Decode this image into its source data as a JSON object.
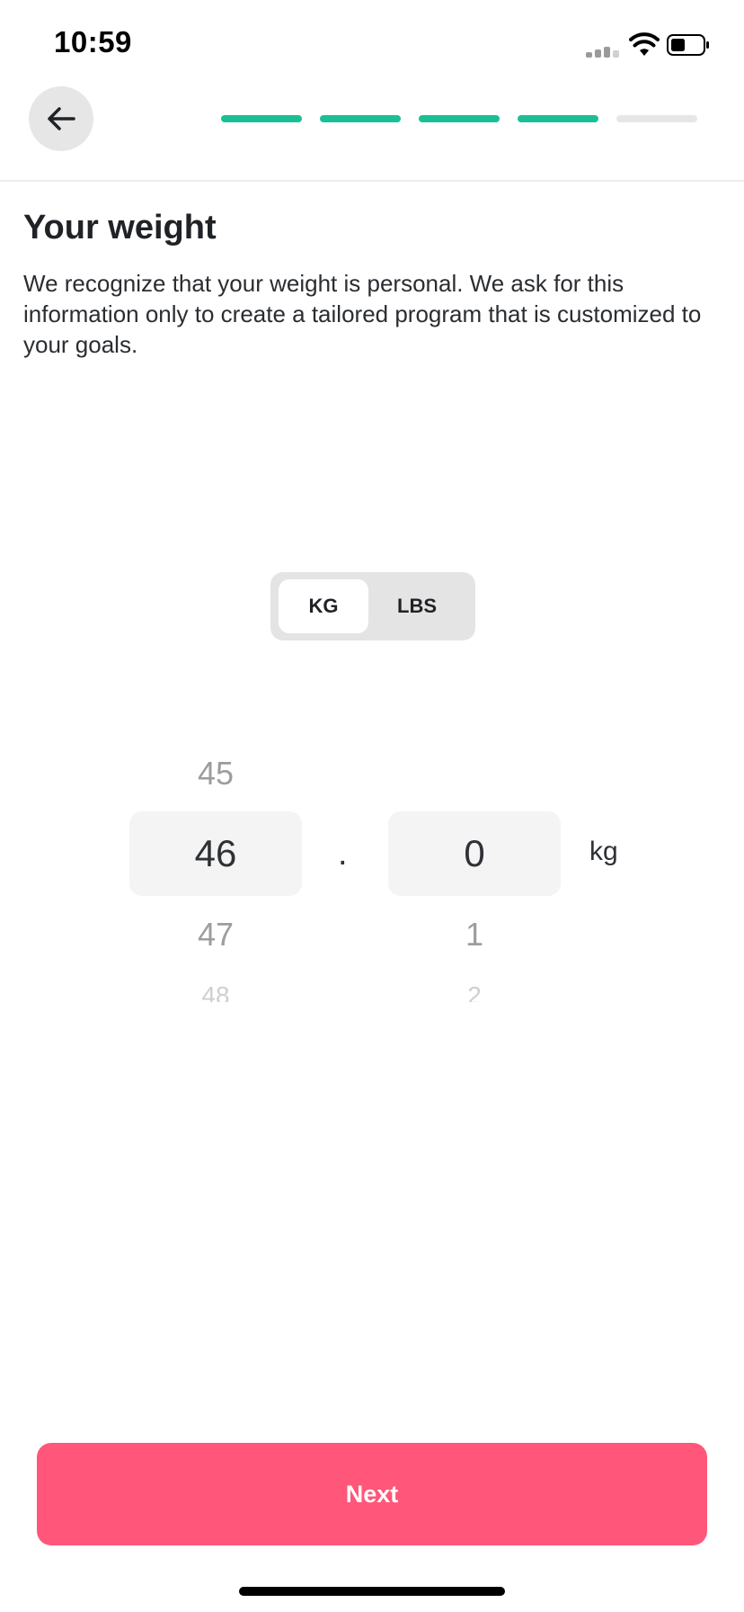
{
  "status_bar": {
    "time": "10:59"
  },
  "header": {
    "back_icon": "arrow-left-icon",
    "progress": {
      "total_steps": 5,
      "completed_steps": 4,
      "active_color": "#1bbf95",
      "inactive_color": "#e6e6e6"
    }
  },
  "page": {
    "title": "Your weight",
    "description": "We recognize that your weight is personal. We ask for this information only to create a tailored program that is customized to your goals."
  },
  "unit_toggle": {
    "options": [
      "KG",
      "LBS"
    ],
    "selected": "KG"
  },
  "picker": {
    "whole": {
      "above": "45",
      "selected": "46",
      "below": "47",
      "below2": "48"
    },
    "separator": ".",
    "fraction": {
      "selected": "0",
      "below": "1",
      "below2": "2"
    },
    "unit": "kg"
  },
  "footer": {
    "next_label": "Next",
    "accent_color": "#ff567a"
  }
}
